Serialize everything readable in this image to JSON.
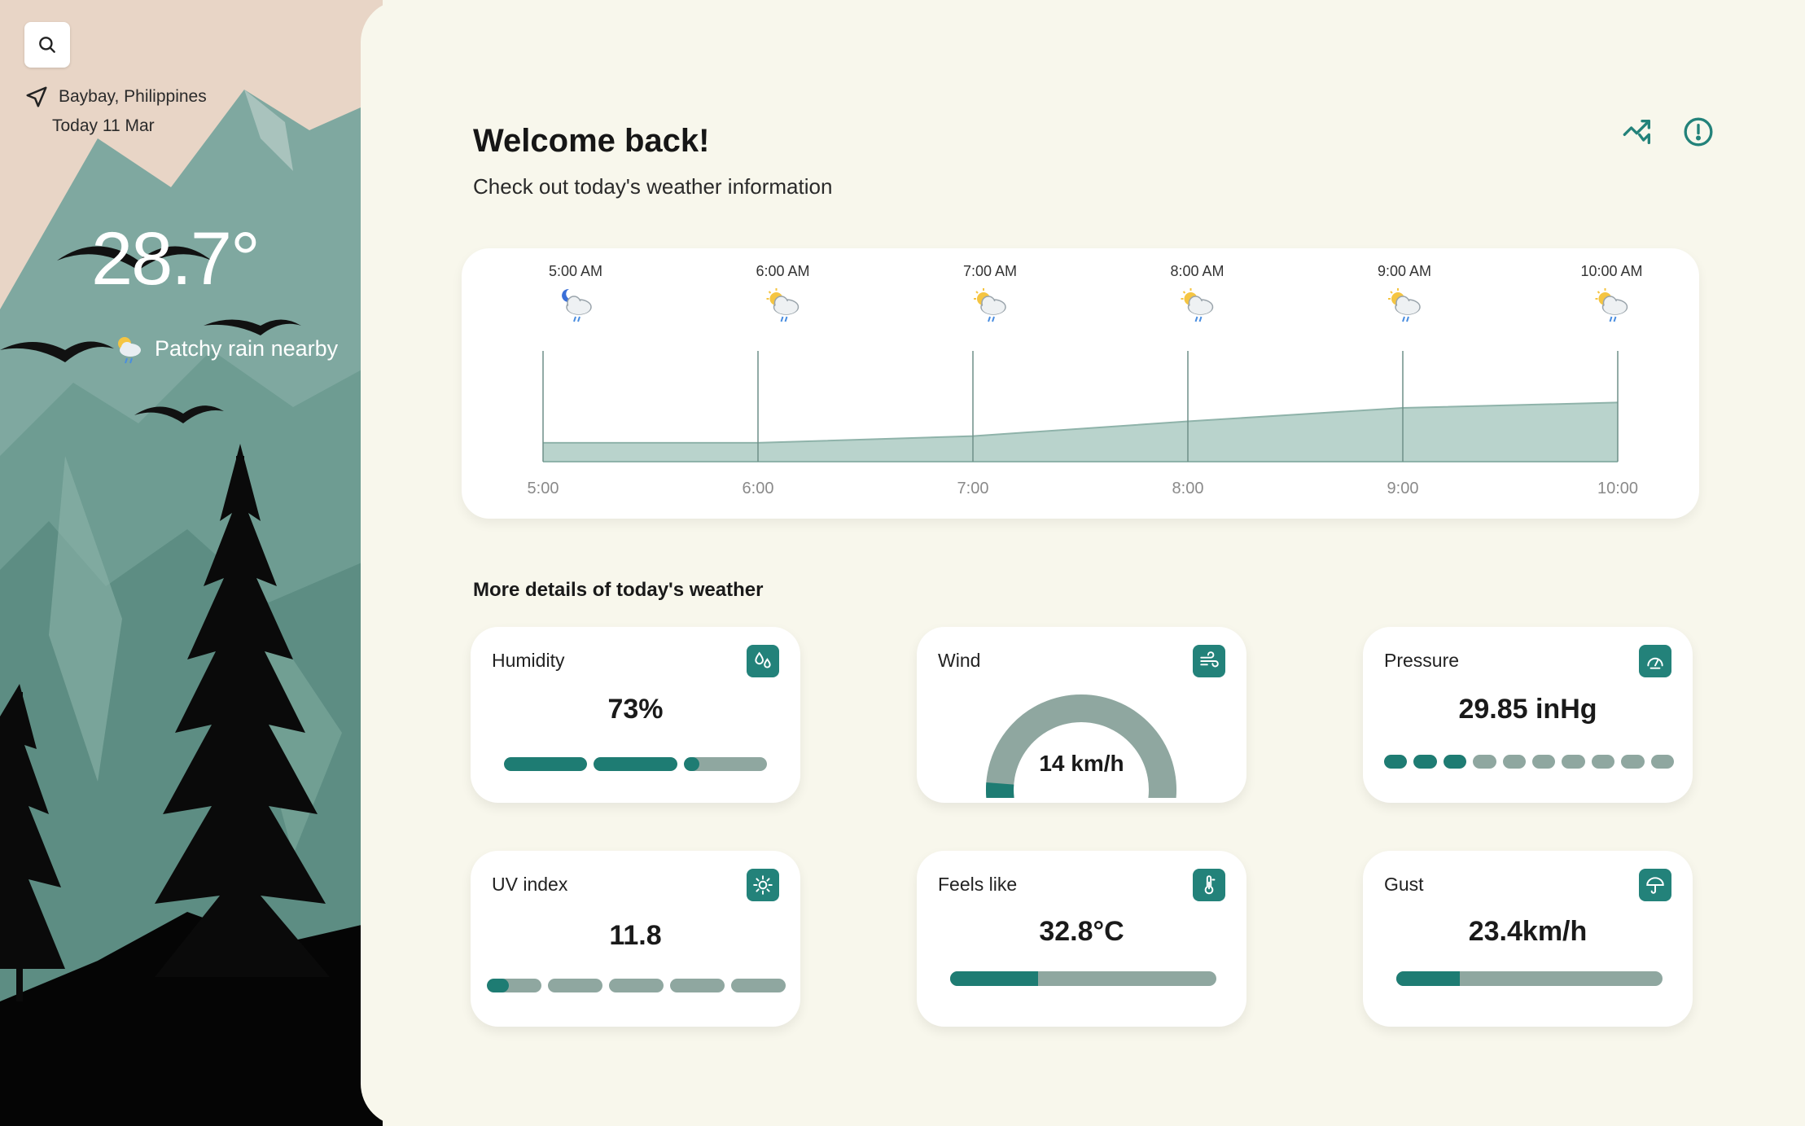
{
  "location": {
    "name": "Baybay, Philippines",
    "date": "Today 11 Mar"
  },
  "current": {
    "temperature": "28.7°",
    "condition": "Patchy rain nearby"
  },
  "header": {
    "title": "Welcome back!",
    "subtitle": "Check out today's weather information",
    "icons": [
      "trend-chart-icon",
      "info-circle-icon"
    ]
  },
  "hourly": {
    "times": [
      "5:00 AM",
      "6:00 AM",
      "7:00 AM",
      "8:00 AM",
      "9:00 AM",
      "10:00 AM"
    ],
    "icons": [
      "moon-cloud-rain-icon",
      "sun-cloud-rain-icon",
      "sun-cloud-rain-icon",
      "sun-cloud-rain-icon",
      "sun-cloud-rain-icon",
      "sun-cloud-rain-icon"
    ]
  },
  "chart_data": {
    "type": "area",
    "x": [
      "5:00",
      "6:00",
      "7:00",
      "8:00",
      "9:00",
      "10:00"
    ],
    "values": [
      25.4,
      25.4,
      25.9,
      27.0,
      28.0,
      28.4
    ],
    "ylim": [
      24,
      32
    ],
    "grid": "vertical"
  },
  "details": {
    "title": "More details of today's weather",
    "humidity": {
      "label": "Humidity",
      "value": "73%",
      "fraction": 0.73,
      "segments": 3,
      "icon": "droplets-icon"
    },
    "wind": {
      "label": "Wind",
      "value": "14 km/h",
      "fraction": 0.09,
      "icon": "wind-icon"
    },
    "pressure": {
      "label": "Pressure",
      "value": "29.85 inHg",
      "filled_segments": 3,
      "segments": 10,
      "icon": "gauge-icon"
    },
    "uv": {
      "label": "UV index",
      "value": "11.8",
      "fraction": 0.08,
      "segments": 5,
      "icon": "sun-icon"
    },
    "feels_like": {
      "label": "Feels like",
      "value": "32.8°C",
      "fraction": 0.33,
      "icon": "thermometer-icon"
    },
    "gust": {
      "label": "Gust",
      "value": "23.4km/h",
      "fraction": 0.24,
      "icon": "umbrella-wind-icon"
    }
  },
  "colors": {
    "accent": "#1e7c73",
    "track": "#8fa7a0",
    "area": "#b9d3cc",
    "page": "#f8f7ec"
  }
}
